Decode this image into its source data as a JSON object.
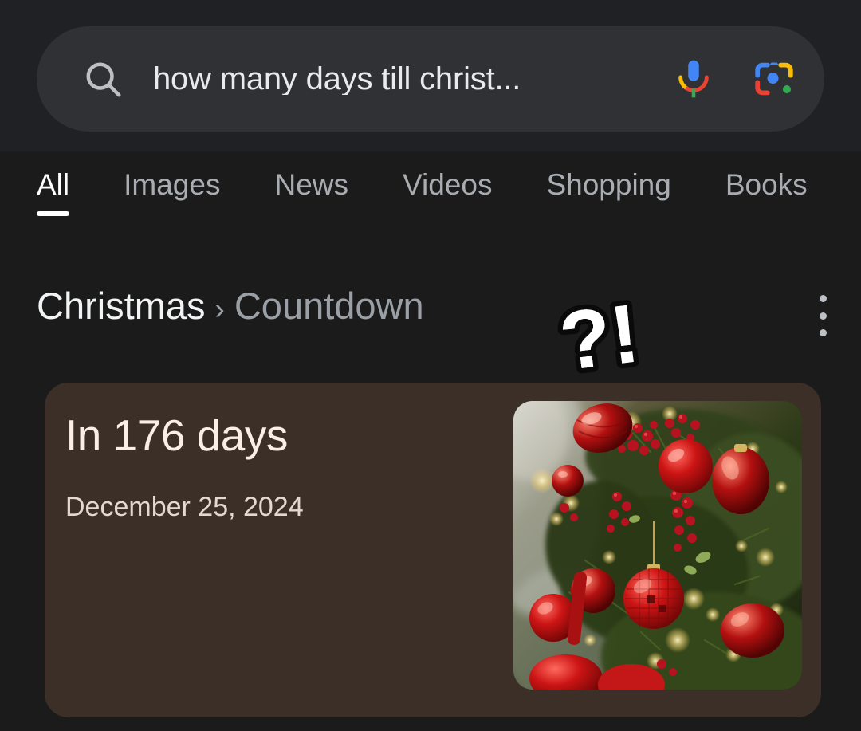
{
  "search": {
    "query": "how many days till christ...",
    "placeholder": "Search",
    "search_icon": "search-icon",
    "mic_icon": "microphone-icon",
    "lens_icon": "google-lens-icon"
  },
  "tabs": [
    {
      "label": "All",
      "active": true
    },
    {
      "label": "Images",
      "active": false
    },
    {
      "label": "News",
      "active": false
    },
    {
      "label": "Videos",
      "active": false
    },
    {
      "label": "Shopping",
      "active": false
    },
    {
      "label": "Books",
      "active": false
    }
  ],
  "breadcrumb": {
    "primary": "Christmas",
    "separator": "›",
    "secondary": "Countdown"
  },
  "overflow": {
    "icon": "more-vert-icon",
    "label": "More options"
  },
  "sticker": {
    "text": "?!",
    "name": "question-exclamation-sticker"
  },
  "answer_card": {
    "headline": "In 176 days",
    "date": "December 25, 2024",
    "days_remaining": 176,
    "target_date": "December 25, 2024",
    "thumbnail_alt": "Christmas tree with red baubles and lights"
  },
  "colors": {
    "page_background": "#1b1b1b",
    "header_background": "#202124",
    "search_bar_fill": "#303134",
    "card_background": "#3b2f28",
    "headline_text": "#fbeee6",
    "date_text": "#e5d8cf",
    "tab_active": "#ffffff",
    "tab_inactive": "#a9adb2",
    "crumb_primary": "#f1f3f4",
    "crumb_secondary": "#9aa0a6",
    "google_blue": "#4285f4",
    "google_red": "#ea4335",
    "google_yellow": "#fbbc05",
    "google_green": "#34a853"
  }
}
